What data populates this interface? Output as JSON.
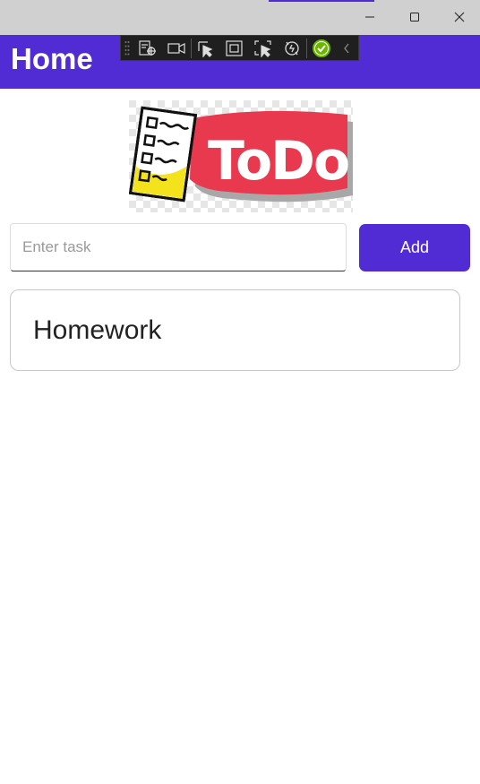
{
  "window": {
    "controls": [
      {
        "name": "minimize-icon"
      },
      {
        "name": "maximize-icon"
      },
      {
        "name": "close-icon"
      }
    ]
  },
  "header": {
    "title": "Home",
    "background": "#512bd4"
  },
  "devtoolbar": {
    "tools": [
      "live-visual-tree-icon",
      "record-icon",
      "select-element-icon",
      "display-layout-adorners-icon",
      "track-focused-element-icon",
      "hot-reload-icon",
      "status-ok-icon",
      "collapse-chevron-icon"
    ]
  },
  "logo": {
    "text": "ToDo",
    "accent": "#e8394f"
  },
  "task_input": {
    "placeholder": "Enter task",
    "value": ""
  },
  "add_button": {
    "label": "Add",
    "color": "#512bd4"
  },
  "tasks": [
    {
      "label": "Homework"
    }
  ]
}
